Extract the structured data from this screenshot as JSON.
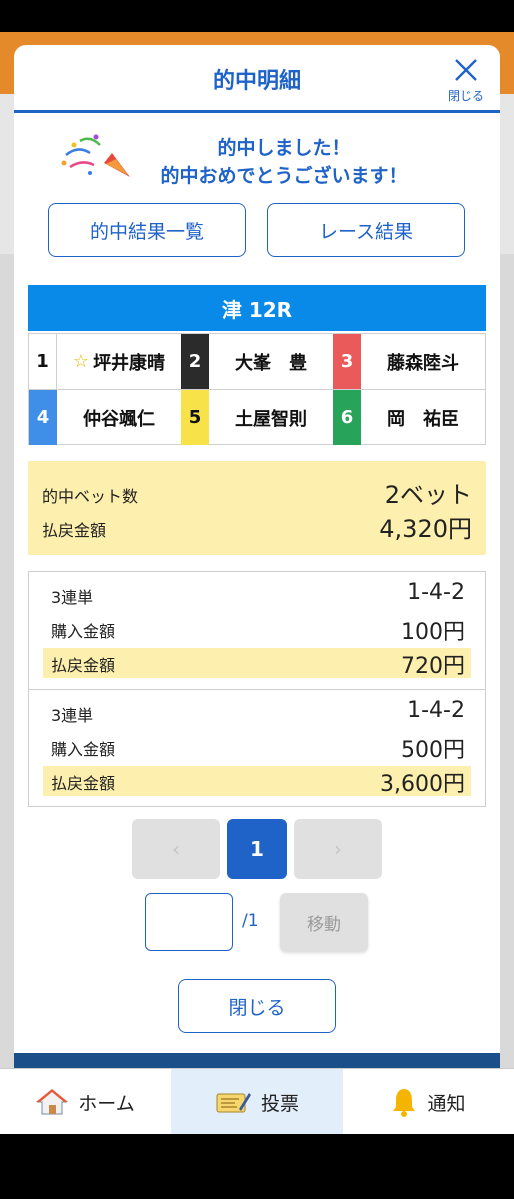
{
  "modal": {
    "title": "的中明細",
    "close_label": "閉じる"
  },
  "congrats": {
    "line1": "的中しました！",
    "line2": "的中おめでとうございます！"
  },
  "buttons": {
    "hit_list": "的中結果一覧",
    "race_result": "レース結果",
    "close": "閉じる"
  },
  "race": {
    "label": "津 12R"
  },
  "racers": [
    {
      "num": "1",
      "name": "坪井康晴",
      "color": "#ffffff",
      "text_color": "#111111",
      "star": true
    },
    {
      "num": "2",
      "name": "大峯　豊",
      "color": "#2b2b2b",
      "text_color": "#ffffff",
      "star": false
    },
    {
      "num": "3",
      "name": "藤森陸斗",
      "color": "#ea5a5a",
      "text_color": "#ffffff",
      "star": false
    },
    {
      "num": "4",
      "name": "仲谷颯仁",
      "color": "#3f8ee8",
      "text_color": "#ffffff",
      "star": false
    },
    {
      "num": "5",
      "name": "土屋智則",
      "color": "#f7e24a",
      "text_color": "#111111",
      "star": false
    },
    {
      "num": "6",
      "name": "岡　祐臣",
      "color": "#27a35a",
      "text_color": "#ffffff",
      "star": false
    }
  ],
  "summary": {
    "hit_bets_label": "的中ベット数",
    "hit_bets_value": "2ベット",
    "payout_label": "払戻金額",
    "payout_value": "4,320円"
  },
  "bets": [
    {
      "type": "3連単",
      "combo": "1-4-2",
      "purchase_label": "購入金額",
      "purchase_value": "100円",
      "payout_label": "払戻金額",
      "payout_value": "720円"
    },
    {
      "type": "3連単",
      "combo": "1-4-2",
      "purchase_label": "購入金額",
      "purchase_value": "500円",
      "payout_label": "払戻金額",
      "payout_value": "3,600円"
    }
  ],
  "pagination": {
    "prev": "‹",
    "current": "1",
    "next": "›",
    "total": "/1",
    "move": "移動"
  },
  "nav": {
    "home": "ホーム",
    "vote": "投票",
    "notify": "通知"
  },
  "colors": {
    "accent": "#1f63c8",
    "race_bar": "#0a8ae8",
    "highlight": "#fdefad",
    "header_orange": "#e58a2a"
  }
}
